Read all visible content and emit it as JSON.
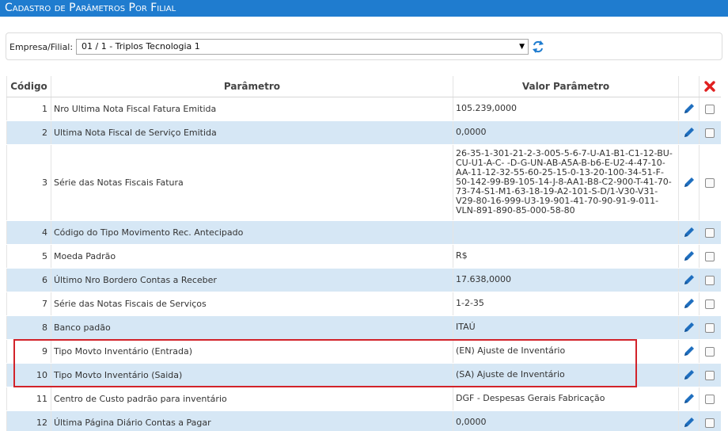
{
  "window": {
    "title": "Cadastro de Parâmetros Por Filial"
  },
  "filter": {
    "label": "Empresa/Filial:",
    "selected": "01 / 1 - Triplos Tecnologia 1"
  },
  "table": {
    "headers": {
      "code": "Código",
      "param": "Parâmetro",
      "value": "Valor Parâmetro"
    },
    "rows": [
      {
        "code": "1",
        "param": "Nro Ultima Nota Fiscal Fatura Emitida",
        "value": "105.239,0000"
      },
      {
        "code": "2",
        "param": "Ultima Nota Fiscal de Serviço Emitida",
        "value": "0,0000"
      },
      {
        "code": "3",
        "param": "Série das Notas Fiscais Fatura",
        "value": "26-35-1-301-21-2-3-005-5-6-7-U-A1-B1-C1-12-BU-CU-U1-A-C- -D-G-UN-AB-A5A-B-b6-E-U2-4-47-10-AA-11-12-32-55-60-25-15-0-13-20-100-34-51-F-50-142-99-B9-105-14-J-8-AA1-B8-C2-900-T-41-70-73-74-S1-M1-63-18-19-A2-101-S-D/1-V30-V31-V29-80-16-999-U3-19-901-41-70-90-91-9-011-VLN-891-890-85-000-58-80"
      },
      {
        "code": "4",
        "param": "Código do Tipo Movimento Rec. Antecipado",
        "value": ""
      },
      {
        "code": "5",
        "param": "Moeda Padrão",
        "value": "R$"
      },
      {
        "code": "6",
        "param": "Último Nro Bordero Contas a Receber",
        "value": "17.638,0000"
      },
      {
        "code": "7",
        "param": "Série das Notas Fiscais de Serviços",
        "value": "1-2-35"
      },
      {
        "code": "8",
        "param": "Banco padão",
        "value": "ITAÚ"
      },
      {
        "code": "9",
        "param": "Tipo Movto Inventário (Entrada)",
        "value": "(EN) Ajuste de Inventário"
      },
      {
        "code": "10",
        "param": "Tipo Movto Inventário (Saida)",
        "value": "(SA) Ajuste de Inventário"
      },
      {
        "code": "11",
        "param": "Centro de Custo padrão para inventário",
        "value": "DGF - Despesas Gerais Fabricação"
      },
      {
        "code": "12",
        "param": "Última Página Diário Contas a Pagar",
        "value": "0,0000"
      }
    ]
  },
  "colors": {
    "header_bar": "#1f7ccf",
    "row_alt": "#d6e7f5",
    "edit_icon": "#1f6fbf",
    "delete_icon": "#e02020",
    "highlight": "#d2232a"
  },
  "icons": {
    "refresh": "refresh-icon",
    "edit": "pencil-icon",
    "delete": "delete-x-icon"
  }
}
